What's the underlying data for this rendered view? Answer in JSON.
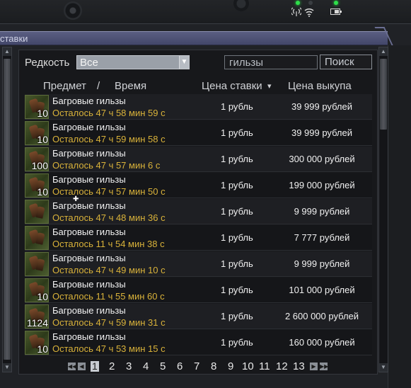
{
  "window": {
    "title": "ставки"
  },
  "filters": {
    "rarity_label": "Редкость",
    "rarity_value": "Все",
    "search_value": "гильзы",
    "search_button": "Поиск"
  },
  "columns": {
    "item": "Предмет",
    "slash": "/",
    "time": "Время",
    "bid": "Цена ставки",
    "sort_indicator": "▾",
    "buyout": "Цена выкупа"
  },
  "rows": [
    {
      "count": "10",
      "name": "Багровые гильзы",
      "time": "Осталось 47 ч 58 мин 59 с",
      "bid": "1 рубль",
      "buyout": "39 999 рублей"
    },
    {
      "count": "10",
      "name": "Багровые гильзы",
      "time": "Осталось 47 ч 59 мин 58 с",
      "bid": "1 рубль",
      "buyout": "39 999 рублей"
    },
    {
      "count": "100",
      "name": "Багровые гильзы",
      "time": "Осталось 47 ч 57 мин 6 с",
      "bid": "1 рубль",
      "buyout": "300 000 рублей"
    },
    {
      "count": "10",
      "name": "Багровые гильзы",
      "time": "Осталось 47 ч 57 мин 50 с",
      "bid": "1 рубль",
      "buyout": "199 000 рублей"
    },
    {
      "count": "",
      "name": "Багровые гильзы",
      "time": "Осталось 47 ч 48 мин 36 с",
      "bid": "1 рубль",
      "buyout": "9 999 рублей"
    },
    {
      "count": "",
      "name": "Багровые гильзы",
      "time": "Осталось 11 ч 54 мин 38 с",
      "bid": "1 рубль",
      "buyout": "7 777 рублей"
    },
    {
      "count": "",
      "name": "Багровые гильзы",
      "time": "Осталось 47 ч 49 мин 10 с",
      "bid": "1 рубль",
      "buyout": "9 999 рублей"
    },
    {
      "count": "10",
      "name": "Багровые гильзы",
      "time": "Осталось 11 ч 55 мин 60 с",
      "bid": "1 рубль",
      "buyout": "101 000 рублей"
    },
    {
      "count": "1124",
      "name": "Багровые гильзы",
      "time": "Осталось 47 ч 59 мин 31 с",
      "bid": "1 рубль",
      "buyout": "2 600 000 рублей"
    },
    {
      "count": "10",
      "name": "Багровые гильзы",
      "time": "Осталось 47 ч 53 мин 15 с",
      "bid": "1 рубль",
      "buyout": "160 000 рублей"
    }
  ],
  "pagination": {
    "current": "1",
    "pages": [
      "1",
      "2",
      "3",
      "4",
      "5",
      "6",
      "7",
      "8",
      "9",
      "10",
      "11",
      "12",
      "13"
    ],
    "icons": {
      "first": "double-left-arrow",
      "prev": "left-arrow",
      "next": "right-arrow",
      "last": "double-right-arrow"
    }
  },
  "colors": {
    "time_text": "#d9b23a",
    "title_bar": "#4f5376",
    "status_led": "#2ee04a"
  }
}
